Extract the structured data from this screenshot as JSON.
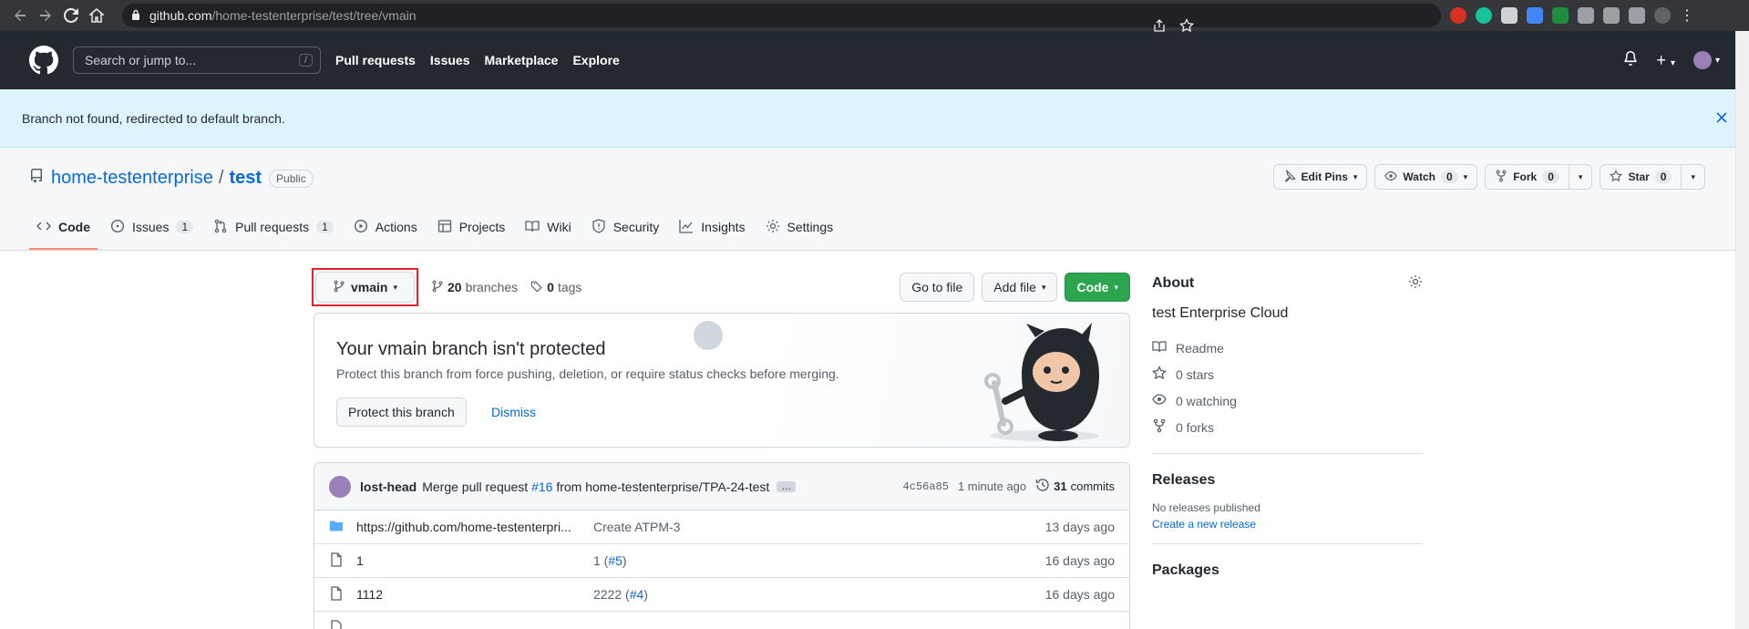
{
  "browser": {
    "url_host": "github.com",
    "url_path": "/home-testenterprise/test/tree/vmain"
  },
  "header": {
    "search_placeholder": "Search or jump to...",
    "search_shortcut": "/",
    "nav": [
      "Pull requests",
      "Issues",
      "Marketplace",
      "Explore"
    ]
  },
  "flash": {
    "message": "Branch not found, redirected to default branch."
  },
  "repo": {
    "owner": "home-testenterprise",
    "separator": "/",
    "name": "test",
    "visibility": "Public",
    "actions": {
      "edit_pins": "Edit Pins",
      "watch": "Watch",
      "watch_count": "0",
      "fork": "Fork",
      "fork_count": "0",
      "star": "Star",
      "star_count": "0"
    },
    "tabs": [
      {
        "label": "Code",
        "count": ""
      },
      {
        "label": "Issues",
        "count": "1"
      },
      {
        "label": "Pull requests",
        "count": "1"
      },
      {
        "label": "Actions",
        "count": ""
      },
      {
        "label": "Projects",
        "count": ""
      },
      {
        "label": "Wiki",
        "count": ""
      },
      {
        "label": "Security",
        "count": ""
      },
      {
        "label": "Insights",
        "count": ""
      },
      {
        "label": "Settings",
        "count": ""
      }
    ]
  },
  "file_nav": {
    "branch": "vmain",
    "branches_count": "20",
    "branches_label": "branches",
    "tags_count": "0",
    "tags_label": "tags",
    "go_to_file": "Go to file",
    "add_file": "Add file",
    "code": "Code"
  },
  "protect": {
    "title": "Your vmain branch isn't protected",
    "description": "Protect this branch from force pushing, deletion, or require status checks before merging.",
    "button": "Protect this branch",
    "dismiss": "Dismiss"
  },
  "commit": {
    "author": "lost-head",
    "message_prefix": "Merge pull request",
    "pr": "#16",
    "message_suffix": "from home-testenterprise/TPA-24-test",
    "ellipsis": "…",
    "sha": "4c56a85",
    "time": "1 minute ago",
    "commits_count": "31",
    "commits_label": "commits"
  },
  "files": [
    {
      "type": "folder",
      "name": "https://github.com/home-testenterpri...",
      "msg": "Create ATPM-3",
      "pr": "",
      "date": "13 days ago"
    },
    {
      "type": "file",
      "name": "1",
      "msg": "1 (",
      "pr": "#5",
      "msg_end": ")",
      "date": "16 days ago"
    },
    {
      "type": "file",
      "name": "1112",
      "msg": "2222 (",
      "pr": "#4",
      "msg_end": ")",
      "date": "16 days ago"
    }
  ],
  "about": {
    "title": "About",
    "description": "test Enterprise Cloud",
    "items": [
      "Readme",
      "0 stars",
      "0 watching",
      "0 forks"
    ]
  },
  "releases": {
    "title": "Releases",
    "none": "No releases published",
    "create": "Create a new release"
  },
  "packages": {
    "title": "Packages"
  }
}
